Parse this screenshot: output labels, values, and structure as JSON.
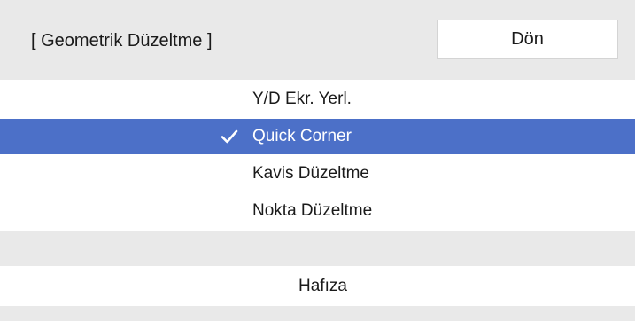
{
  "header": {
    "title": "[ Geometrik Düzeltme ]",
    "back_label": "Dön"
  },
  "menu": {
    "items": [
      {
        "label": "Y/D Ekr. Yerl.",
        "selected": false
      },
      {
        "label": "Quick Corner",
        "selected": true,
        "check_icon": "checkmark-icon"
      },
      {
        "label": "Kavis Düzeltme",
        "selected": false
      },
      {
        "label": "Nokta Düzeltme",
        "selected": false
      }
    ]
  },
  "memory": {
    "label": "Hafıza"
  },
  "colors": {
    "header_bg": "#e9e9e9",
    "selected_bg": "#4c70c8",
    "selected_text": "#ffffff",
    "text": "#1a1a1a"
  }
}
